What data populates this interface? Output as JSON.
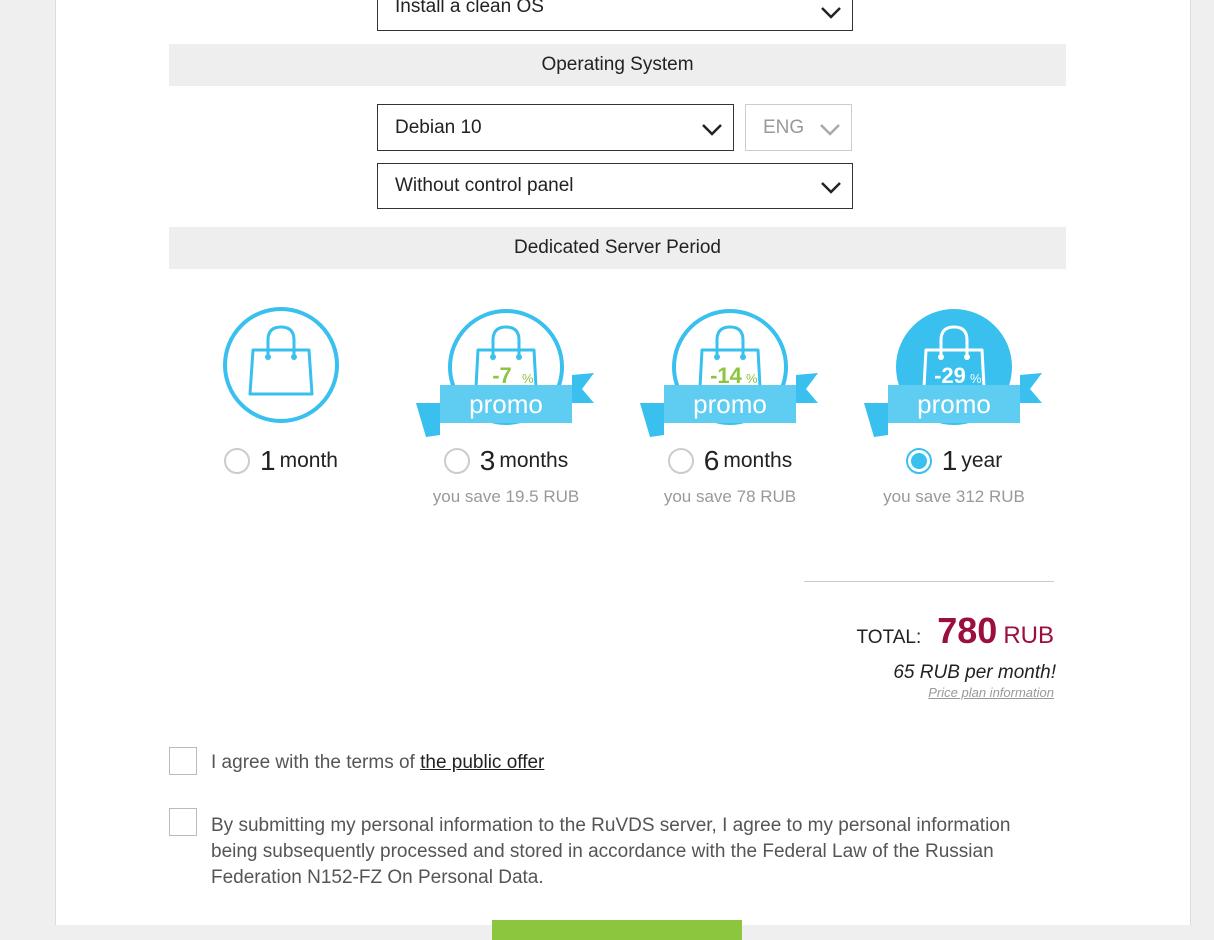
{
  "install_select": {
    "value": "Install a clean OS"
  },
  "os_section": {
    "title": "Operating System"
  },
  "os_select": {
    "value": "Debian 10"
  },
  "lang_select": {
    "value": "ENG"
  },
  "panel_select": {
    "value": "Without control panel"
  },
  "period_section": {
    "title": "Dedicated Server Period"
  },
  "periods": [
    {
      "num": "1",
      "unit": "month",
      "discount": "",
      "promo": "",
      "save": "",
      "selected": false
    },
    {
      "num": "3",
      "unit": "months",
      "discount": "-7",
      "percent": "%",
      "promo": "promo",
      "save": "you save 19.5 RUB",
      "selected": false
    },
    {
      "num": "6",
      "unit": "months",
      "discount": "-14",
      "percent": "%",
      "promo": "promo",
      "save": "you save 78 RUB",
      "selected": false
    },
    {
      "num": "1",
      "unit": "year",
      "discount": "-29",
      "percent": "%",
      "promo": "promo",
      "save": "you save 312 RUB",
      "selected": true
    }
  ],
  "total": {
    "label": "TOTAL:",
    "amount": "780",
    "currency": "RUB",
    "per_month": "65 RUB per month!",
    "plan_link": "Price plan information"
  },
  "agreements": {
    "offer_prefix": "I agree with the terms of ",
    "offer_link": "the public offer",
    "personal_data": "By submitting my personal information to the RuVDS server, I agree to my personal information being subsequently processed and stored in accordance with the Federal Law of the Russian Federation N152-FZ On Personal Data."
  },
  "colors": {
    "accent": "#39c0ee",
    "promo_ribbon": "#5fcdf1",
    "discount": "#8cc63f",
    "total": "#9b0f3e",
    "submit": "#8cc63f"
  }
}
